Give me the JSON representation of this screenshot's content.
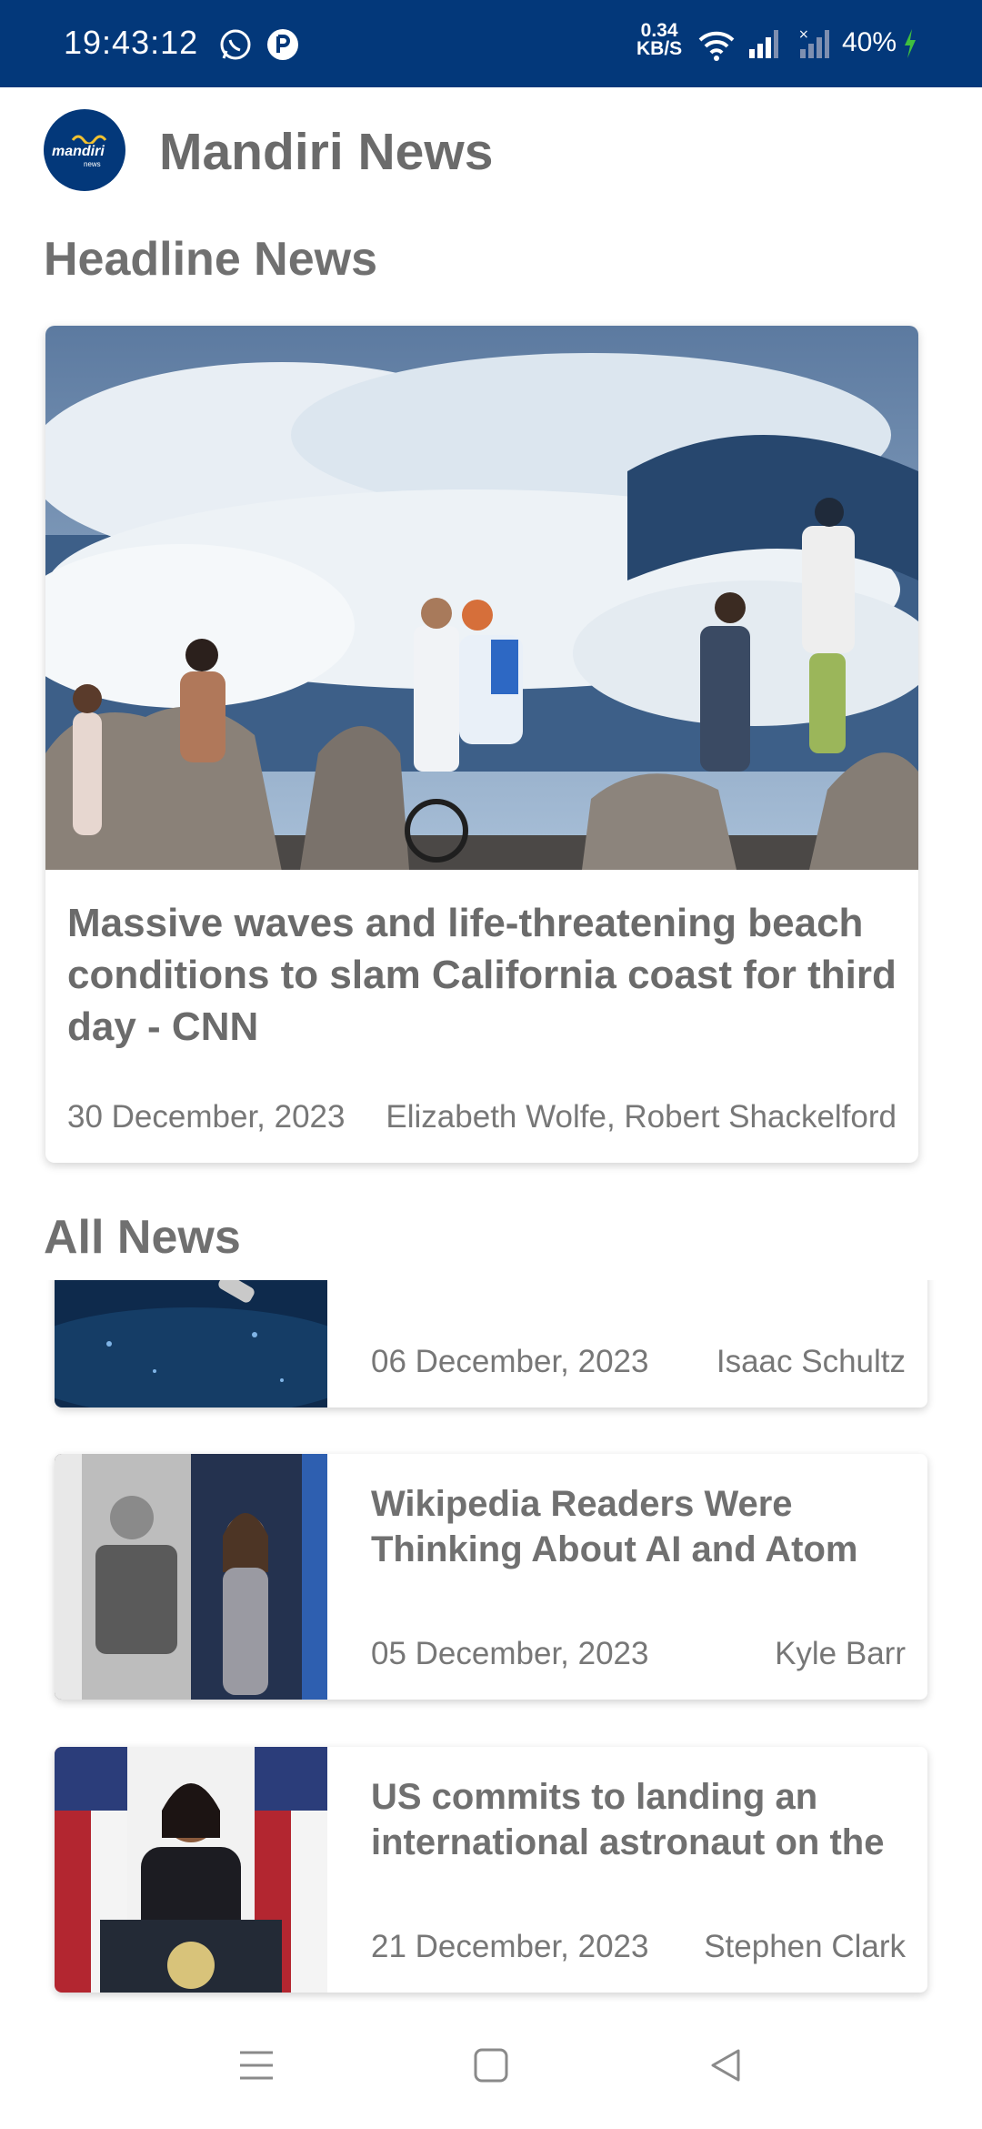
{
  "status_bar": {
    "time": "19:43:12",
    "speed_value": "0.34",
    "speed_unit": "KB/S",
    "battery": "40%",
    "icons": [
      "whatsapp-icon",
      "app-notification-icon",
      "wifi-icon",
      "signal-icon",
      "no-signal-icon",
      "charging-icon"
    ]
  },
  "header": {
    "app_title": "Mandiri News",
    "logo_text": "mandiri",
    "logo_sub": "news"
  },
  "headline": {
    "section_title": "Headline News",
    "title": "Massive waves and life-threatening beach conditions to slam California coast for third day - CNN",
    "date": "30 December, 2023",
    "author": "Elizabeth Wolfe, Robert Shackelford"
  },
  "all_news": {
    "section_title": "All News",
    "items": [
      {
        "title": "",
        "date": "06 December, 2023",
        "author": "Isaac Schultz"
      },
      {
        "title": "Wikipedia Readers Were Thinking About AI and Atom",
        "date": "05 December, 2023",
        "author": "Kyle Barr"
      },
      {
        "title": "US commits to landing an international astronaut on the",
        "date": "21 December, 2023",
        "author": "Stephen Clark"
      }
    ]
  },
  "nav_bar": {
    "icons": [
      "menu-icon",
      "home-icon",
      "back-icon"
    ]
  },
  "colors": {
    "primary": "#03387a",
    "text_gray": "#6b6b6b",
    "accent_gold": "#f2c230"
  }
}
